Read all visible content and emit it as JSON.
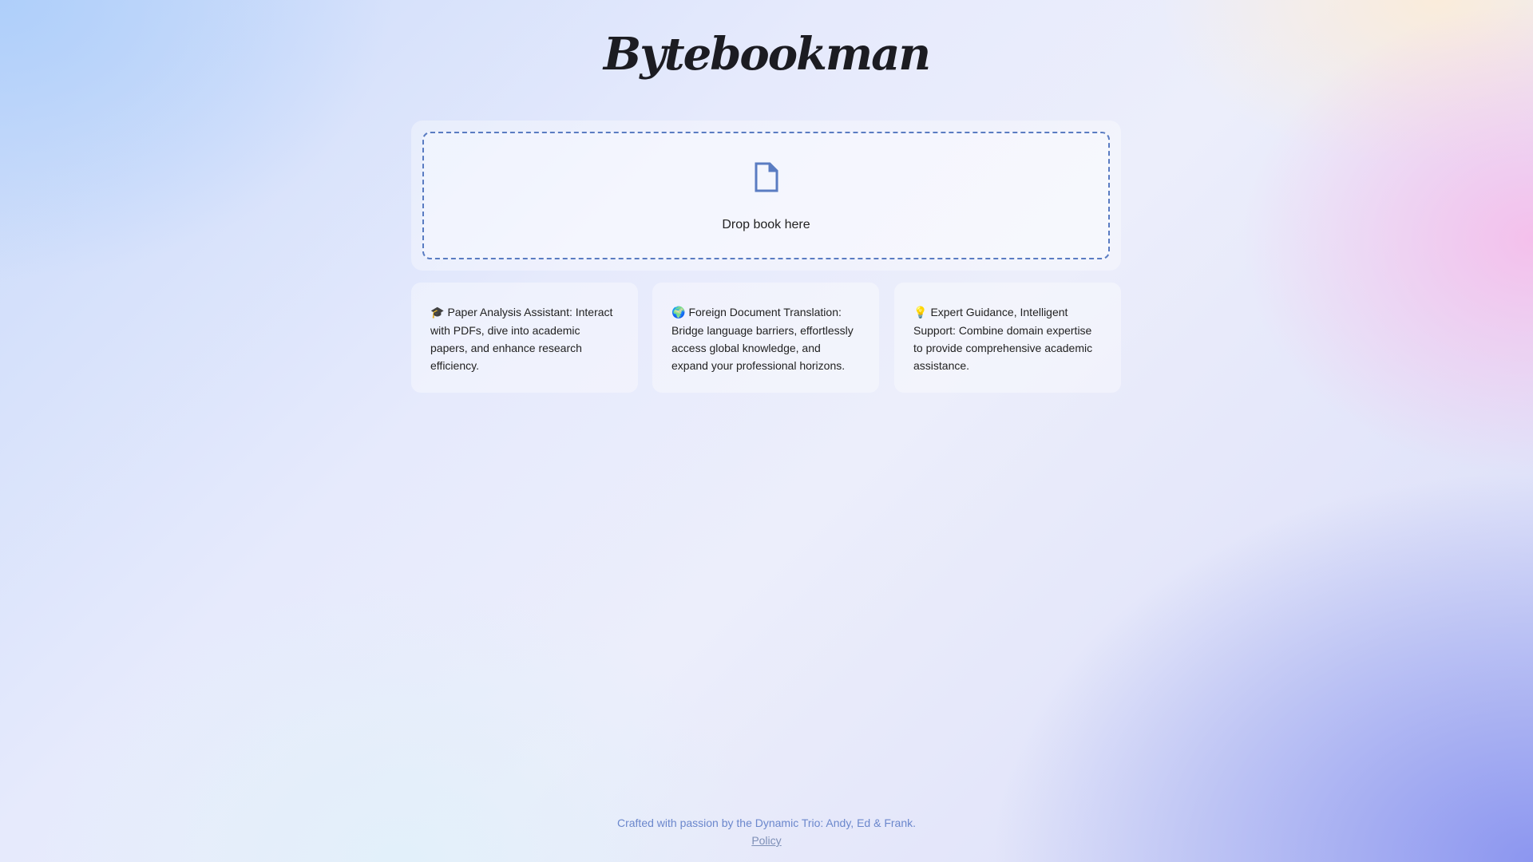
{
  "header": {
    "logo_text": "Bytebookman"
  },
  "upload": {
    "icon": "file-icon",
    "label": "Drop book here",
    "accent_color": "#5a7cc2"
  },
  "features": [
    {
      "emoji": "🎓",
      "text": "Paper Analysis Assistant: Interact with PDFs, dive into academic papers, and enhance research efficiency."
    },
    {
      "emoji": "🌍",
      "text": "Foreign Document Translation: Bridge language barriers, effortlessly access global knowledge, and expand your professional horizons."
    },
    {
      "emoji": "💡",
      "text": "Expert Guidance, Intelligent Support: Combine domain expertise to provide comprehensive academic assistance."
    }
  ],
  "footer": {
    "credit": "Crafted with passion by the Dynamic Trio: Andy, Ed & Frank.",
    "policy_link": "Policy"
  }
}
